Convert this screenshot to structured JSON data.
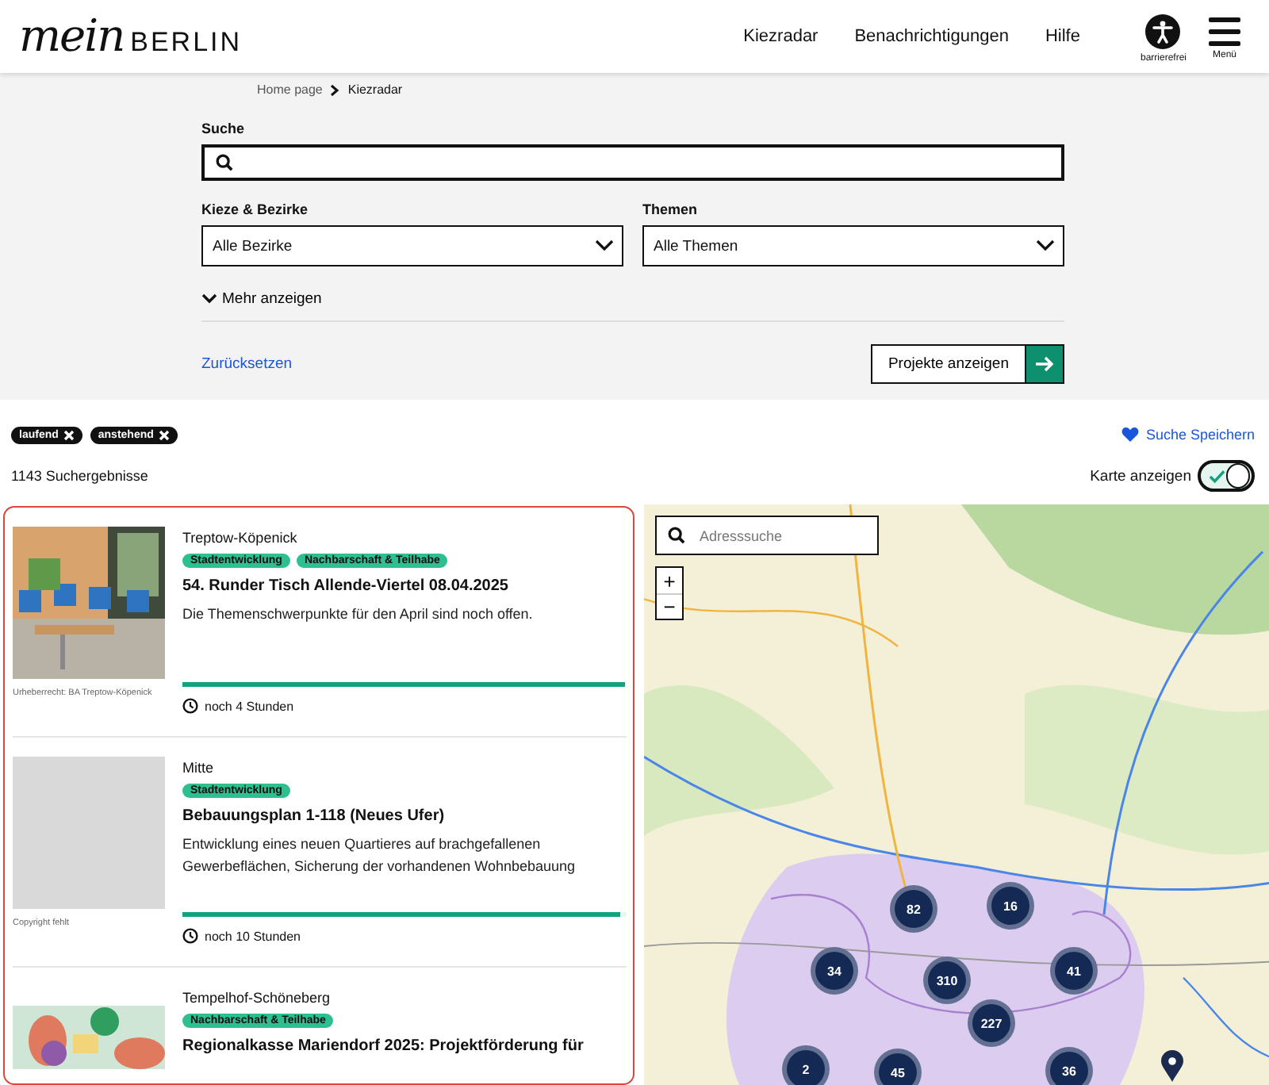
{
  "header": {
    "logo_script": "mein",
    "logo_word": "BERLIN",
    "nav": [
      {
        "label": "Kiezradar",
        "selected": false
      },
      {
        "label": "Benachrichtigungen",
        "selected": false
      },
      {
        "label": "Hilfe",
        "selected": false
      }
    ],
    "accessibility_label": "barrierefrei",
    "menu_label": "Menü"
  },
  "breadcrumb": [
    "Home page",
    "Kiezradar"
  ],
  "filters": {
    "search_label": "Suche",
    "district_label": "Kieze & Bezirke",
    "district_value": "Alle Bezirke",
    "topic_label": "Themen",
    "topic_value": "Alle Themen",
    "more": "Mehr anzeigen",
    "reset": "Zurücksetzen",
    "submit": "Projekte anzeigen"
  },
  "chips": [
    "laufend",
    "anstehend"
  ],
  "save_search": "Suche Speichern",
  "result_count": "1143 Suchergebnisse",
  "map_toggle": {
    "label": "Karte anzeigen",
    "on": true
  },
  "results": [
    {
      "caption": "Urheberrecht: BA Treptow-Köpenick",
      "district": "Treptow-Köpenick",
      "tags": [
        "Stadtentwicklung",
        "Nachbarschaft & Teilhabe"
      ],
      "title": "54. Runder Tisch Allende-Viertel 08.04.2025",
      "description": "Die Themenschwerpunkte für den April sind noch offen.",
      "level": 0.995,
      "remaining": "noch 4 Stunden"
    },
    {
      "kind": "placeholder",
      "caption": "Copyright fehlt",
      "district": "Mitte",
      "tags": [
        "Stadtentwicklung"
      ],
      "title": "Bebauungsplan 1-118 (Neues Ufer)",
      "description": "Entwicklung eines neuen Quartieres auf brachgefallenen Gewerbeflächen, Sicherung der vorhandenen Wohnbebauung",
      "level": 0.985,
      "remaining": "noch 10 Stunden"
    },
    {
      "kind": "illustration",
      "district": "Tempelhof-Schöneberg",
      "tags": [
        "Nachbarschaft & Teilhabe"
      ],
      "title": "Regionalkasse Mariendorf 2025: Projektförderung für"
    }
  ],
  "map": {
    "search_placeholder": "Adresssuche",
    "zoom_in": "+",
    "zoom_out": "−",
    "clusters": [
      {
        "count": "82"
      },
      {
        "count": "16"
      },
      {
        "count": "34"
      },
      {
        "count": "310"
      },
      {
        "count": "41"
      },
      {
        "count": "227"
      },
      {
        "count": "2"
      },
      {
        "count": "45"
      },
      {
        "count": "36"
      }
    ]
  }
}
